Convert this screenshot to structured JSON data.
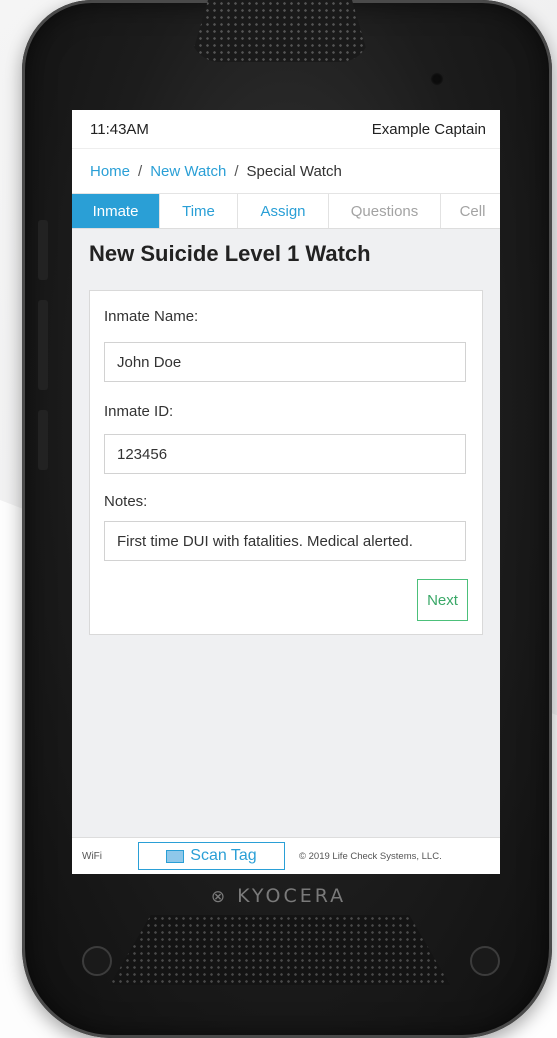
{
  "status_bar": {
    "time": "11:43AM",
    "user": "Example Captain"
  },
  "breadcrumb": {
    "home": "Home",
    "sep1": "/",
    "new_watch": "New Watch",
    "sep2": "/",
    "current": "Special Watch"
  },
  "tabs": [
    {
      "label": "Inmate",
      "state": "active"
    },
    {
      "label": "Time",
      "state": "enabled"
    },
    {
      "label": "Assign",
      "state": "enabled"
    },
    {
      "label": "Questions",
      "state": "disabled"
    },
    {
      "label": "Cell",
      "state": "disabled"
    }
  ],
  "page": {
    "title": "New Suicide Level 1 Watch"
  },
  "form": {
    "name_label": "Inmate Name:",
    "name_value": "John Doe",
    "id_label": "Inmate ID:",
    "id_value": "123456",
    "notes_label": "Notes:",
    "notes_value": "First time DUI with fatalities. Medical alerted.",
    "next_label": "Next"
  },
  "footer": {
    "wifi": "WiFi",
    "scan_label": "Scan Tag",
    "copyright": "© 2019 Life Check Systems, LLC."
  },
  "device": {
    "brand": "KYOCERA"
  },
  "colors": {
    "accent": "#2a9fd6",
    "next_green": "#3aa868",
    "screen_bg": "#eff0f2"
  },
  "icons": {
    "scan": "scan-tag-icon"
  }
}
